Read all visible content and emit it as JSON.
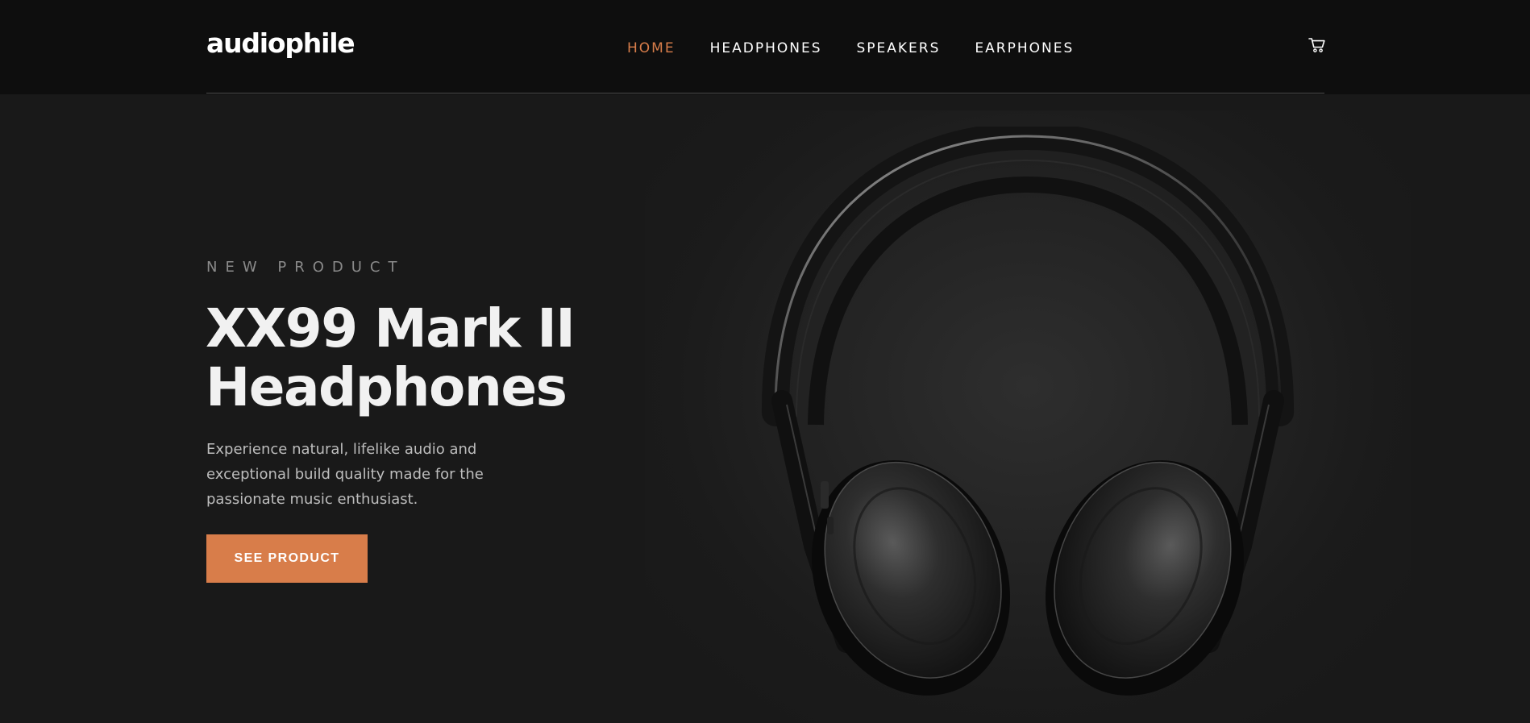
{
  "header": {
    "logo": "audiophile",
    "nav": [
      {
        "label": "HOME",
        "active": true
      },
      {
        "label": "HEADPHONES",
        "active": false
      },
      {
        "label": "SPEAKERS",
        "active": false
      },
      {
        "label": "EARPHONES",
        "active": false
      }
    ],
    "cart_icon": "cart-icon"
  },
  "hero": {
    "overline": "NEW PRODUCT",
    "title_line1": "XX99 Mark II",
    "title_line2": "Headphones",
    "description": "Experience natural, lifelike audio and exceptional build quality made for the passionate music enthusiast.",
    "cta_label": "SEE PRODUCT",
    "image": "headphones-image"
  },
  "colors": {
    "accent": "#d87d4a",
    "header_bg": "#0e0e0e",
    "hero_bg": "#191919",
    "text_primary": "#ffffff",
    "text_muted": "#8a8a8a"
  }
}
